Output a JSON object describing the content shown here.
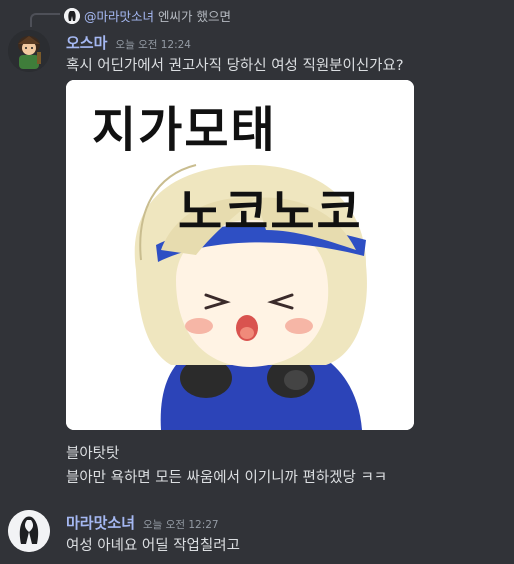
{
  "reply": {
    "author": "@마라맛소녀",
    "text": "엔씨가 했으면"
  },
  "message1": {
    "author": "오스마",
    "author_color": "#a5b8f2",
    "timestamp": "오늘 오전 12:24",
    "text": "혹시 어딘가에서 권고사직 당하신 여성 직원분이신가요?",
    "sticker": {
      "line1": "지가모태",
      "line2": "노코노코"
    },
    "caption1": "블아탓탓",
    "caption2": "블아만 욕하면 모든 싸움에서 이기니까 편하겠당 ㅋㅋ"
  },
  "message2": {
    "author": "마라맛소녀",
    "author_color": "#a5b8f2",
    "timestamp": "오늘 오전 12:27",
    "text": "여성 아녜요 어딜 작업칠려고"
  }
}
